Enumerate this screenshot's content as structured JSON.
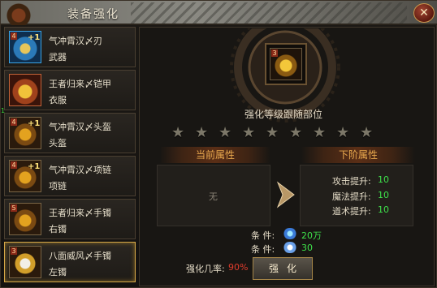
{
  "window": {
    "title": "装备强化",
    "close_label": "✕"
  },
  "items": [
    {
      "name": "气冲霄汉〆刃",
      "type": "武器",
      "level_badge": "4",
      "plus": "+1",
      "icon": "blade-icon",
      "style": "blue"
    },
    {
      "name": "王者归来〆铠甲",
      "type": "衣服",
      "level_badge": "",
      "plus": "",
      "icon": "armor-icon",
      "style": "red"
    },
    {
      "name": "气冲霄汉〆头盔",
      "type": "头盔",
      "level_badge": "4",
      "plus": "+1",
      "icon": "helmet-icon",
      "style": "gold"
    },
    {
      "name": "气冲霄汉〆项链",
      "type": "项链",
      "level_badge": "4",
      "plus": "+1",
      "icon": "necklace-icon",
      "style": "gold"
    },
    {
      "name": "王者归来〆手镯",
      "type": "右镯",
      "level_badge": "5",
      "plus": "",
      "icon": "bracelet-icon",
      "style": "gold"
    },
    {
      "name": "八面威风〆手镯",
      "type": "左镯",
      "level_badge": "3",
      "plus": "",
      "icon": "bracelet-icon",
      "style": "white"
    }
  ],
  "side_marker": "1",
  "main": {
    "slot_level": "3",
    "follow_text": "强化等级跟随部位",
    "stars_total": 9,
    "stars_lit": 0,
    "current_header": "当前属性",
    "next_header": "下阶属性",
    "current_empty": "无",
    "next_attrs": [
      {
        "label": "攻击提升:",
        "value": "10"
      },
      {
        "label": "魔法提升:",
        "value": "10"
      },
      {
        "label": "道术提升:",
        "value": "10"
      }
    ],
    "conditions": [
      {
        "label": "条    件:",
        "value": "20万",
        "icon": "gem-icon"
      },
      {
        "label": "条    件:",
        "value": "30",
        "icon": "crystal-icon"
      }
    ],
    "rate_label": "强化几率:",
    "rate_value": "90%",
    "enhance_button": "强化"
  },
  "colors": {
    "accent": "#e8a84e",
    "positive": "#3ee04a",
    "danger": "#e03c2c",
    "border_gold": "#d6a848"
  }
}
